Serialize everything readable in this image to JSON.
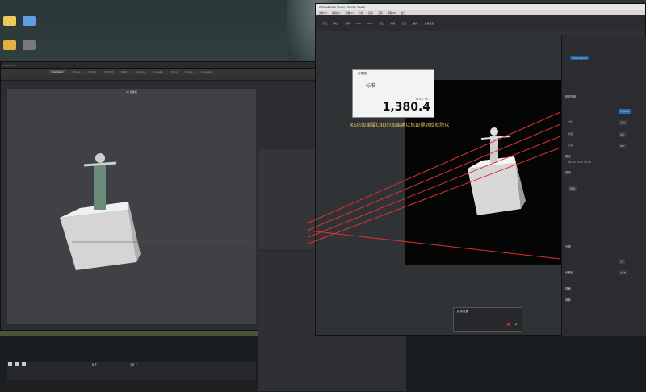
{
  "desktop": {
    "icons": [
      {
        "label": "",
        "color": "#f0c95a"
      },
      {
        "label": "",
        "color": "#5f9fe0"
      },
      {
        "label": "",
        "color": "#e0b040"
      },
      {
        "label": "",
        "color": "#7a7a7a"
      }
    ]
  },
  "c4d": {
    "menus": [
      "Standard",
      "Model",
      "Sculpt",
      "UV Edit",
      "Paint",
      "Rigging",
      "Animate",
      "Track",
      "Nodes",
      "Visualize"
    ],
    "active_menu": "Standard",
    "viewport_title": "KS 摄像机",
    "frame_current": "0 F",
    "frame_end": "90 F"
  },
  "octane": {
    "title": "OctaneRender Studio+ Render Viewer",
    "menu": [
      "文件(F)",
      "编辑(E)",
      "查看(V)",
      "分析",
      "渲染",
      "工具",
      "帮助(H)",
      "窗口"
    ],
    "tools": [
      "开始",
      "停止",
      "暂停",
      "CPU",
      "GPU",
      "导出",
      "相机",
      "工具",
      "偏好",
      "渲染设置"
    ],
    "right_panel": {
      "camera_item": "Free Camera",
      "sec_camera": "相机投射",
      "lens_value": "1380.4",
      "focal_label": "方位",
      "focal_value": "-54°",
      "fov_label": "视距",
      "fov_value": "20°",
      "height_label": "高度",
      "height_value": "10°",
      "sec_focus": "焦点",
      "focus_coords": "69.39  127.5  50.09",
      "sec_dof": "景深",
      "auto_focus": "自动",
      "sec_aperture": "光圈",
      "aperture_value": "50",
      "sec_ratio": "长宽比",
      "ratio_value": "18.8",
      "sec_clip": "剪裁",
      "sec_more": "其他"
    },
    "dialog": {
      "title": "景深设置",
      "btn_ok": "✔",
      "btn_cancel": "✖"
    }
  },
  "calc": {
    "title": "计算器",
    "mode": "标准",
    "expression": "23.8 × 58 =",
    "result": "1,380.4"
  },
  "annotation": "KS的距离要C4D的距离乘以焦距得到反就除以",
  "colors": {
    "redline": "#e03030",
    "accent": "#3a8fd6"
  }
}
